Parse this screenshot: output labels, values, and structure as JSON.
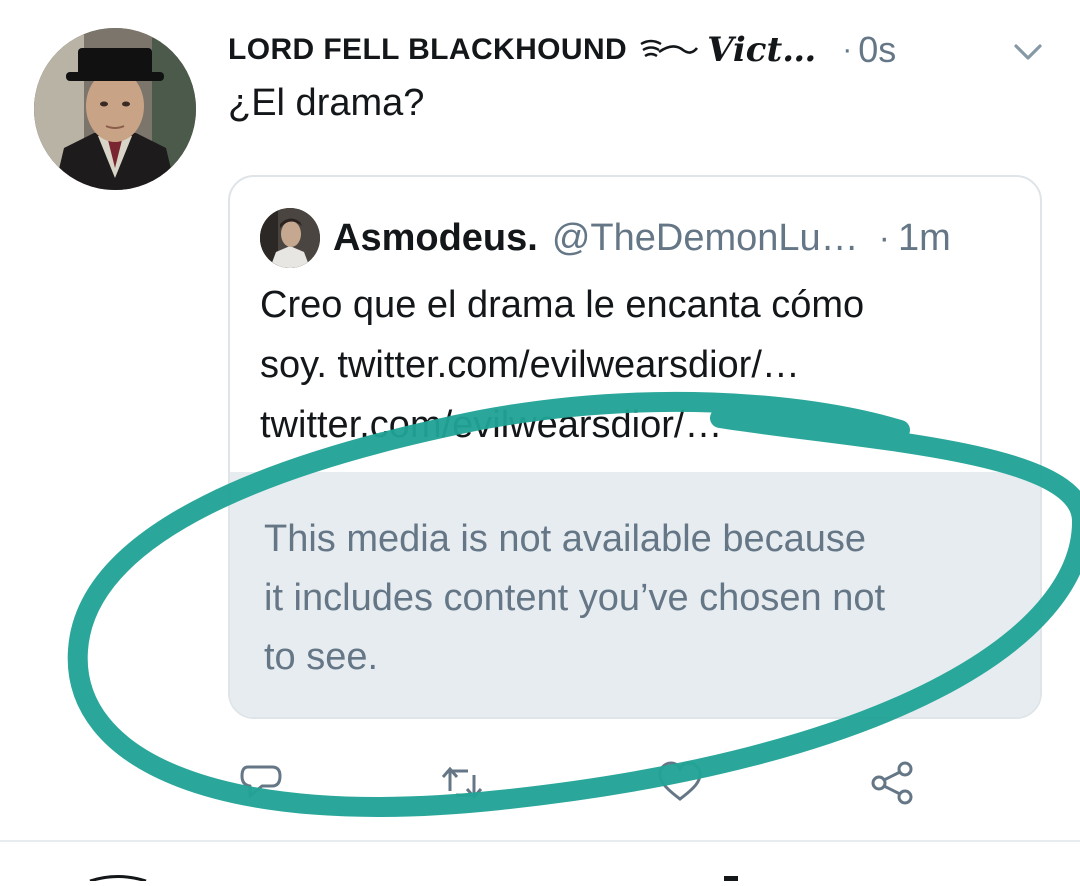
{
  "tweet": {
    "display_name": "LORD FELL BLACKHOUND",
    "name_suffix": "Vict…",
    "separator": "·",
    "time": "0s",
    "text": "¿El drama?",
    "menu_icon": "chevron-down-icon"
  },
  "quote": {
    "name": "Asmodeus.",
    "handle": "@TheDemonLu…",
    "separator": "·",
    "time": "1m",
    "text_lines": [
      "Creo que el drama le encanta cómo",
      "soy. twitter.com/evilwearsdior/…",
      "twitter.com/evilwearsdior/…"
    ],
    "media_notice_lines": [
      "This media is not available because",
      "it includes content you’ve chosen not",
      "to see."
    ]
  },
  "actions": {
    "icons": [
      "reply-icon",
      "retweet-icon",
      "like-icon",
      "share-icon"
    ]
  },
  "colors": {
    "text": "#14171a",
    "secondary": "#657786",
    "notice_bg": "#e6ecf0",
    "border": "#dfe4e8",
    "annotation": "#1f9e8f"
  }
}
